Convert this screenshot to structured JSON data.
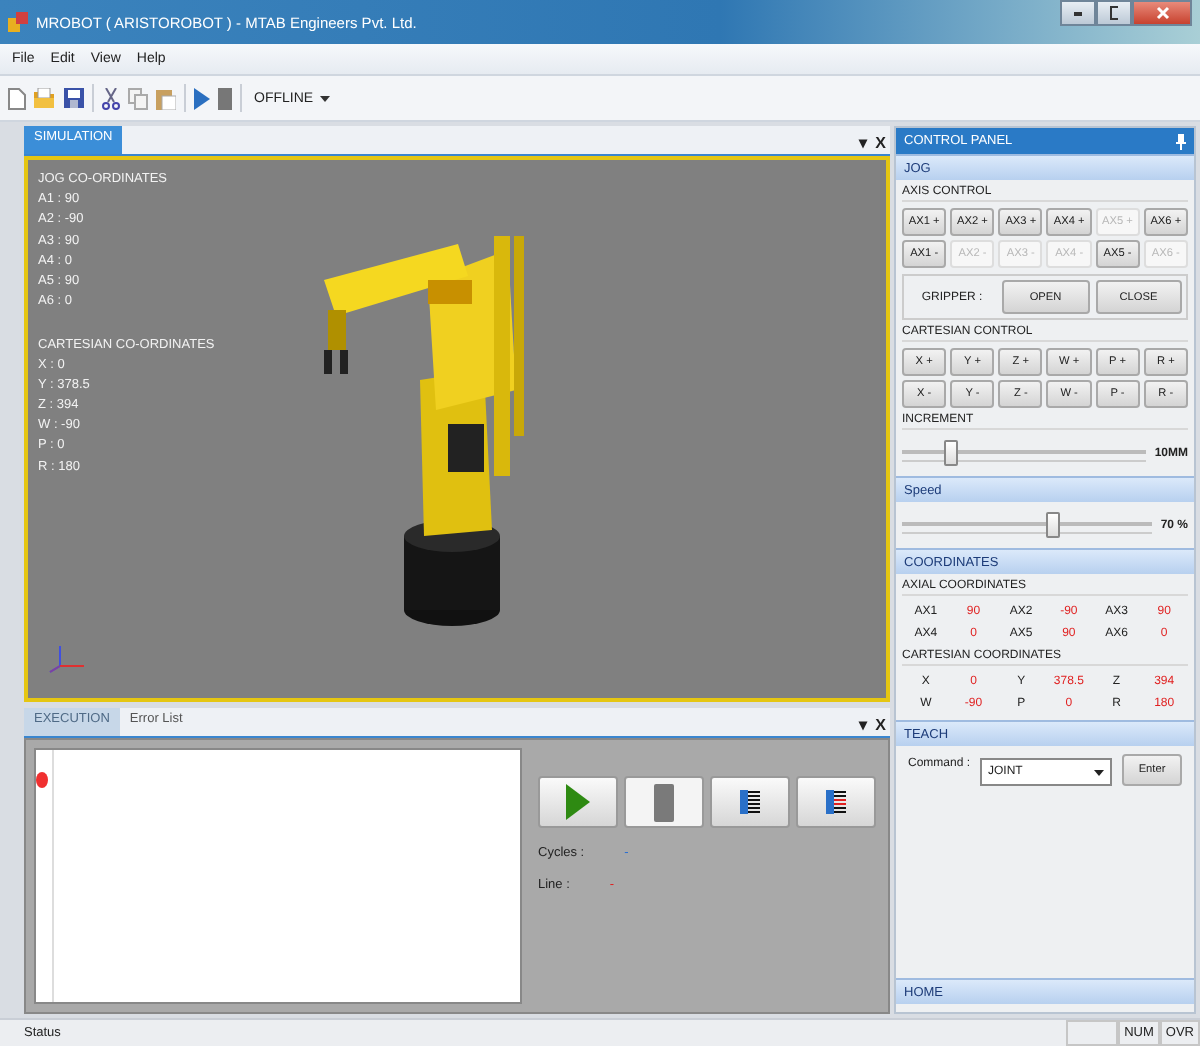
{
  "window": {
    "title": "MROBOT ( ARISTOROBOT ) - MTAB Engineers Pvt. Ltd."
  },
  "menu": [
    "File",
    "Edit",
    "View",
    "Help"
  ],
  "toolbar": {
    "mode": "OFFLINE"
  },
  "simulation": {
    "tab": {
      "label": "SIMULATION",
      "selected": true
    },
    "header_glyphs": [
      "▾",
      "X"
    ],
    "jog_title": "JOG CO-ORDINATES",
    "jog": [
      "A1 : 90",
      "A2 : -90",
      "A3 : 90",
      "A4 : 0",
      "A5 : 90",
      "A6 : 0"
    ],
    "cartesian_title": "CARTESIAN CO-ORDINATES",
    "cartesian": [
      "X  : 0",
      "Y  : 378.5",
      "Z  : 394",
      "W  : -90",
      "P  : 0",
      "R  : 180"
    ]
  },
  "execution": {
    "tabs": [
      {
        "label": "EXECUTION",
        "selected": true
      },
      {
        "label": "Error List",
        "selected": false
      }
    ],
    "header_glyphs": [
      "▾",
      "X"
    ],
    "cycles_label": "Cycles :",
    "cycles_value": "-",
    "line_label": "Line :",
    "line_value": "-"
  },
  "control_panel": {
    "title": "CONTROL PANEL",
    "jog": {
      "title": "JOG",
      "axis_label": "AXIS CONTROL",
      "axis_buttons": [
        {
          "label": "AX1 +",
          "enabled": true
        },
        {
          "label": "AX2 +",
          "enabled": true
        },
        {
          "label": "AX3 +",
          "enabled": true
        },
        {
          "label": "AX4 +",
          "enabled": true
        },
        {
          "label": "AX5 +",
          "enabled": false
        },
        {
          "label": "AX6 +",
          "enabled": true
        },
        {
          "label": "AX1 -",
          "enabled": true
        },
        {
          "label": "AX2 -",
          "enabled": false
        },
        {
          "label": "AX3 -",
          "enabled": false
        },
        {
          "label": "AX4 -",
          "enabled": false
        },
        {
          "label": "AX5 -",
          "enabled": true
        },
        {
          "label": "AX6 -",
          "enabled": false
        }
      ],
      "gripper_label": "GRIPPER :",
      "gripper_buttons": [
        "OPEN",
        "CLOSE"
      ],
      "cartesian_label": "CARTESIAN CONTROL",
      "cartesian_buttons": [
        "X +",
        "Y +",
        "Z +",
        "W +",
        "P +",
        "R +",
        "X -",
        "Y -",
        "Z -",
        "W -",
        "P -",
        "R -"
      ],
      "increment_label": "INCREMENT",
      "increment": {
        "level": 0.2,
        "reading": "10MM"
      }
    },
    "speed": {
      "title": "Speed",
      "level": 0.6,
      "reading": "70 %"
    },
    "coordinates": {
      "title": "COORDINATES",
      "axial_label": "AXIAL COORDINATES",
      "axial": [
        {
          "name": "AX1",
          "value": "90"
        },
        {
          "name": "AX2",
          "value": "-90"
        },
        {
          "name": "AX3",
          "value": "90"
        },
        {
          "name": "AX4",
          "value": "0"
        },
        {
          "name": "AX5",
          "value": "90"
        },
        {
          "name": "AX6",
          "value": "0"
        }
      ],
      "cartesian_label": "CARTESIAN COORDINATES",
      "cartesian": [
        {
          "name": "X",
          "value": "0"
        },
        {
          "name": "Y",
          "value": "378.5"
        },
        {
          "name": "Z",
          "value": "394"
        },
        {
          "name": "W",
          "value": "-90"
        },
        {
          "name": "P",
          "value": "0"
        },
        {
          "name": "R",
          "value": "180"
        }
      ]
    },
    "teach": {
      "title": "TEACH",
      "command_label": "Command :",
      "command_value": "JOINT",
      "enter": "Enter"
    },
    "home": {
      "title": "HOME"
    }
  },
  "status_bar": {
    "text": "Status",
    "indicators": [
      "NUM",
      "OVR"
    ]
  }
}
